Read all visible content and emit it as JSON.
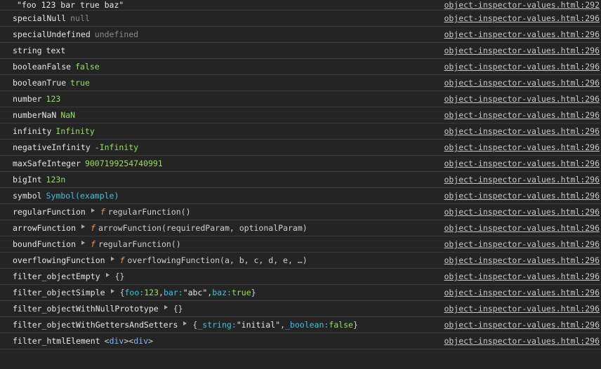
{
  "source_link": "object-inspector-values.html:296",
  "source_link_first": "object-inspector-values.html:292",
  "rows": [
    {
      "key": "specialNull",
      "value": "null"
    },
    {
      "key": "specialUndefined",
      "value": "undefined"
    },
    {
      "key": "string",
      "value": "text"
    },
    {
      "key": "booleanFalse",
      "value": "false"
    },
    {
      "key": "booleanTrue",
      "value": "true"
    },
    {
      "key": "number",
      "value": "123"
    },
    {
      "key": "numberNaN",
      "value": "NaN"
    },
    {
      "key": "infinity",
      "value": "Infinity"
    },
    {
      "key": "negativeInfinity",
      "value": "-Infinity"
    },
    {
      "key": "maxSafeInteger",
      "value": "9007199254740991"
    },
    {
      "key": "bigInt",
      "value": "123n"
    },
    {
      "key": "symbol",
      "value": "Symbol(example)"
    },
    {
      "key": "regularFunction",
      "fn": "f",
      "value": "regularFunction()"
    },
    {
      "key": "arrowFunction",
      "fn": "f",
      "value": "arrowFunction(requiredParam, optionalParam)"
    },
    {
      "key": "boundFunction",
      "fn": "f",
      "value": "regularFunction()"
    },
    {
      "key": "overflowingFunction",
      "fn": "f",
      "value": "overflowingFunction(a, b, c, d, e, …)"
    },
    {
      "key": "filter_objectEmpty",
      "value": "{}"
    },
    {
      "key": "filter_objectSimple"
    },
    {
      "key": "filter_objectWithNullPrototype",
      "value": "{}"
    },
    {
      "key": "filter_objectWithGettersAndSetters"
    },
    {
      "key": "filter_htmlElement"
    }
  ],
  "first_row_text": "\"foo 123 bar true baz\"",
  "objectSimple": {
    "open": "{",
    "k1": "foo",
    "v1": "123",
    "k2": "bar",
    "v2": "\"abc\"",
    "k3": "baz",
    "v3": "true",
    "close": "}",
    "colon": ": ",
    "comma": ", "
  },
  "objectGS": {
    "open": "{",
    "k1": "_string",
    "v1": "\"initial\"",
    "k2": "_boolean",
    "v2": "false",
    "close": "}"
  },
  "htmlElement": {
    "lt1": "<",
    "tag1": "div",
    "gt1": ">",
    "lt2": "<",
    "tag2": "div",
    "gt2": ">"
  }
}
